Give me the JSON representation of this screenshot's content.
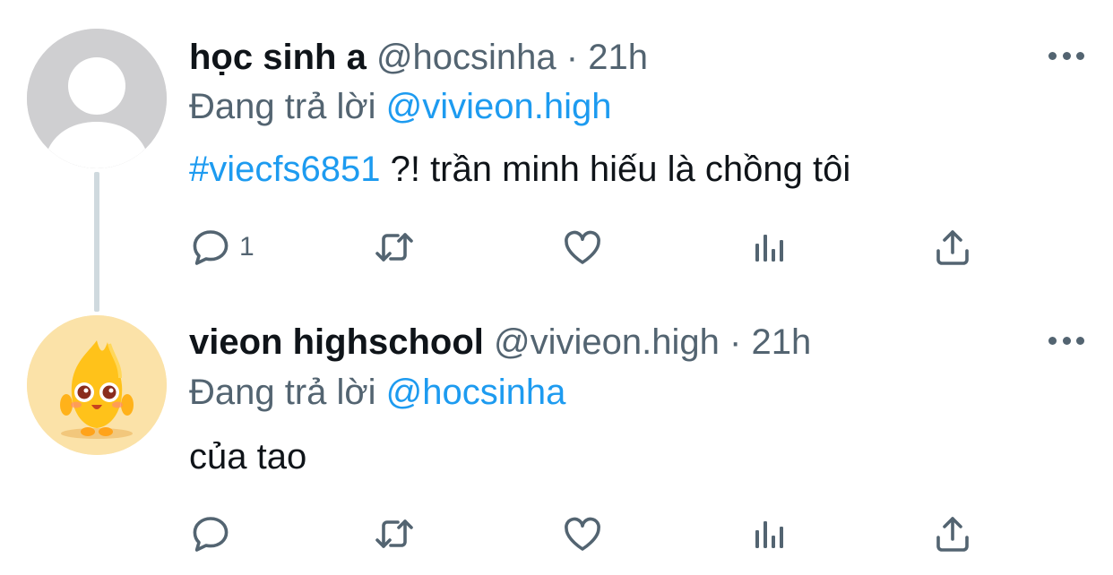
{
  "tweets": [
    {
      "display_name": "học sinh a",
      "handle": "@hocsinha",
      "separator": "·",
      "time": "21h",
      "replying_label": "Đang trả lời",
      "replying_to": "@vivieon.high",
      "hashtag": "#viecfs6851",
      "text": " ?! trần minh hiếu là chồng tôi",
      "reply_count": "1",
      "avatar": "default-profile-avatar"
    },
    {
      "display_name": "vieon highschool",
      "handle": "@vivieon.high",
      "separator": "·",
      "time": "21h",
      "replying_label": "Đang trả lời",
      "replying_to": "@hocsinha",
      "text": "của tao",
      "reply_count": "",
      "avatar": "yellow-mascot-avatar"
    }
  ],
  "icons": [
    "comment-icon",
    "retweet-icon",
    "heart-icon",
    "analytics-icon",
    "share-icon",
    "more-options-icon"
  ],
  "colors": {
    "accent": "#1d9bf0",
    "text": "#0f1419",
    "secondary": "#536471",
    "thread_line": "#cfd9de"
  }
}
